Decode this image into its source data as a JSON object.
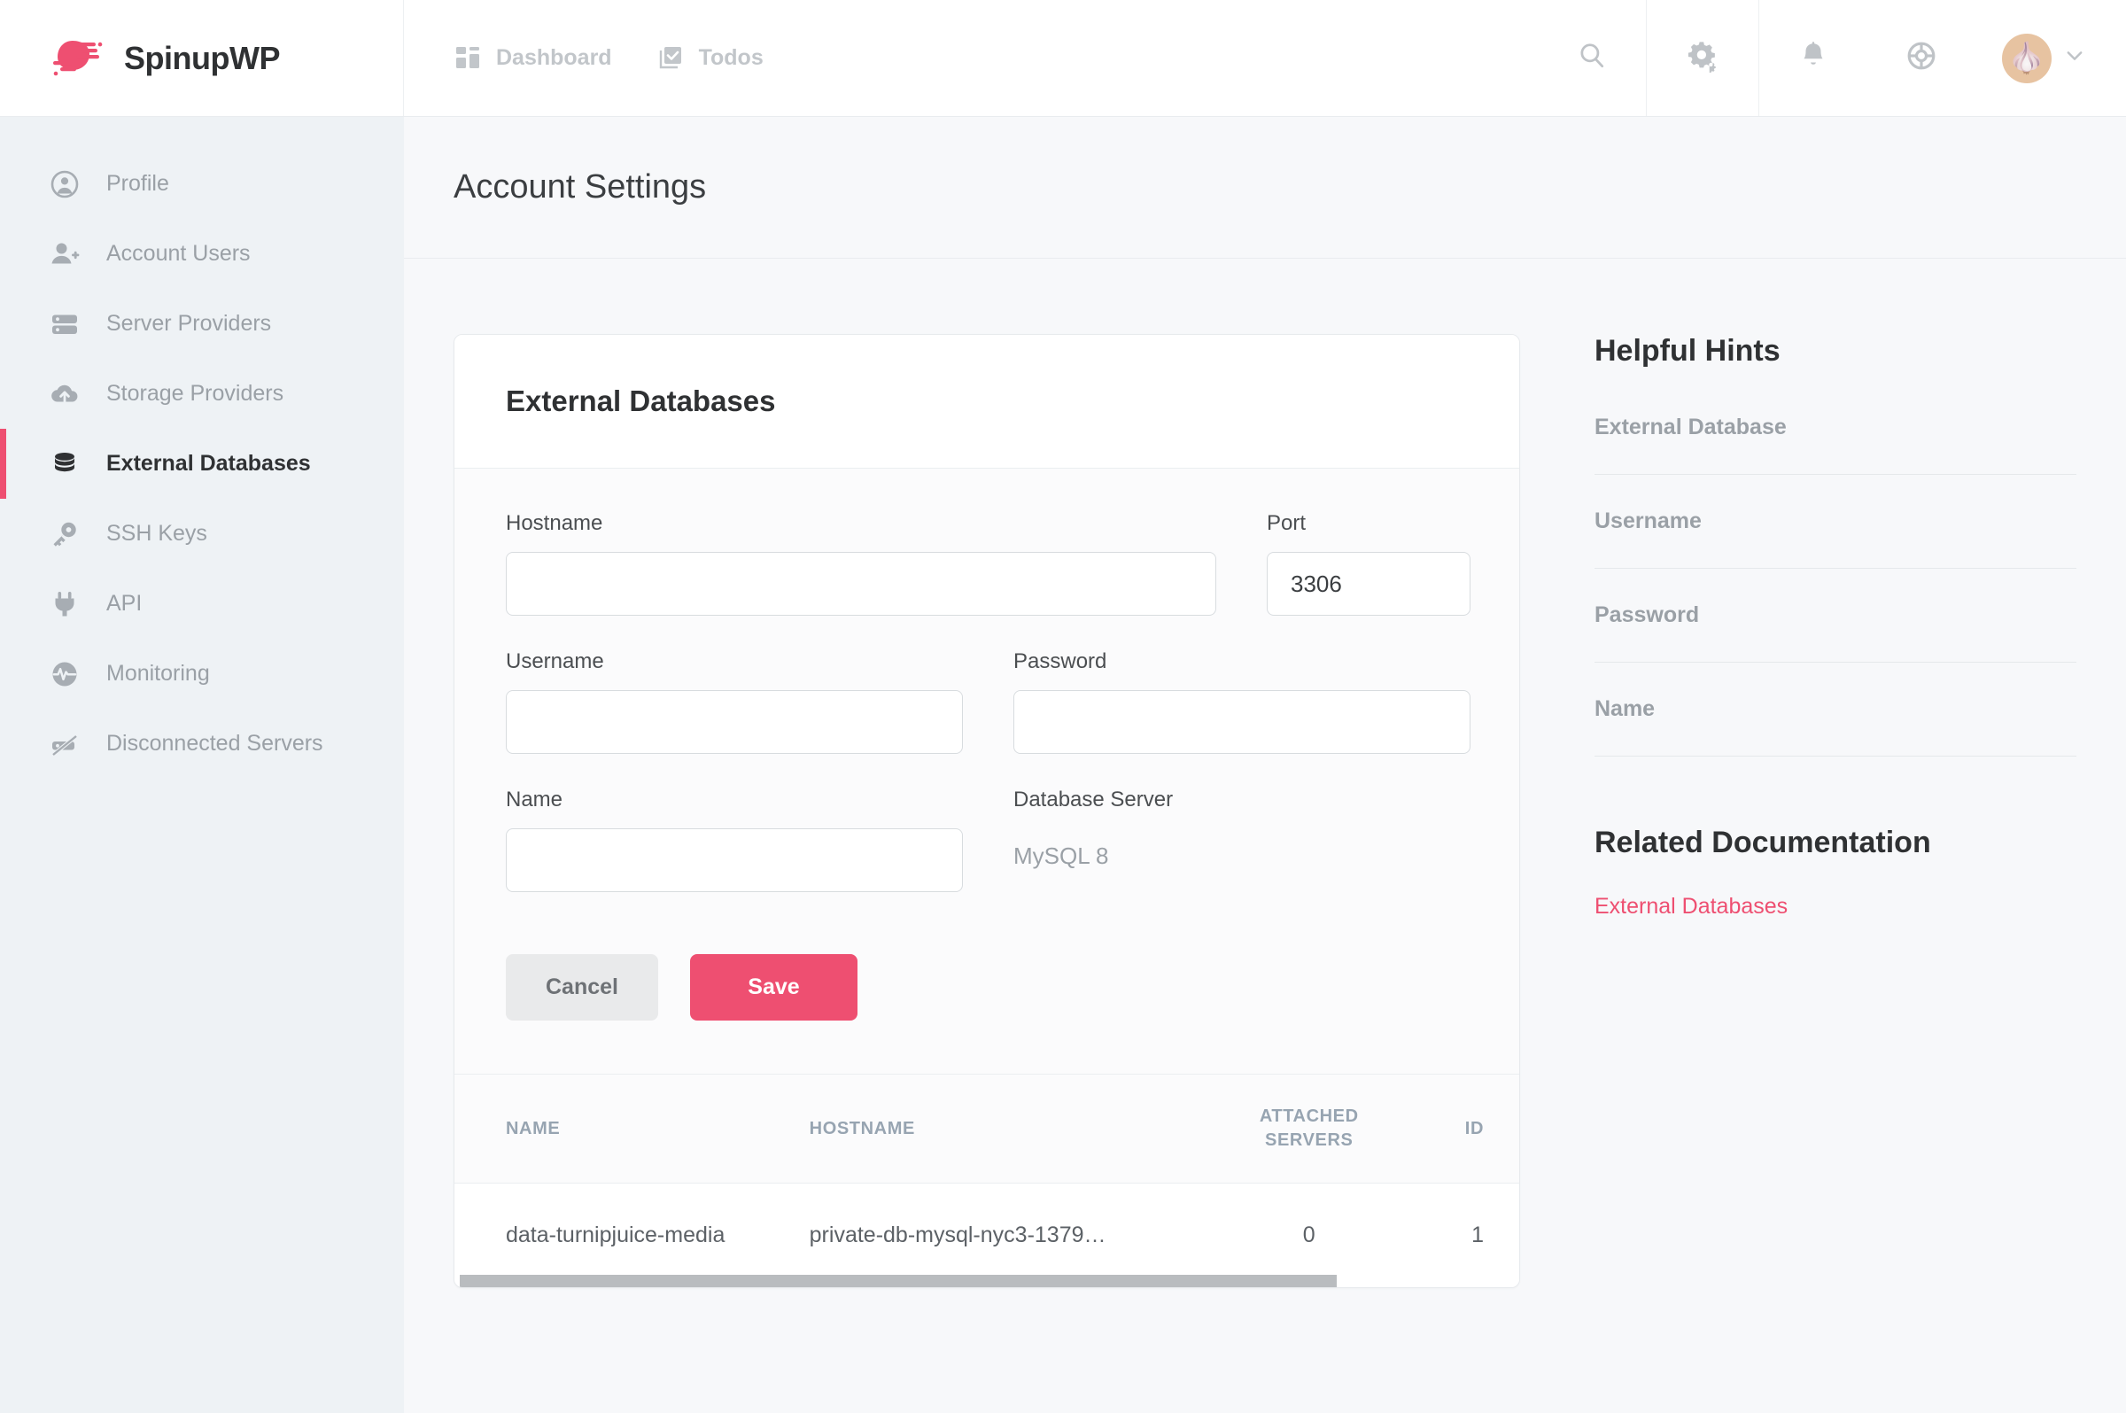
{
  "brand": {
    "name": "SpinupWP",
    "logo_color": "#ee4f71"
  },
  "topnav": {
    "items": [
      {
        "label": "Dashboard",
        "icon": "dashboard-grid-icon"
      },
      {
        "label": "Todos",
        "icon": "checkbox-list-icon"
      }
    ]
  },
  "topright": {
    "search": "search-icon",
    "settings": "gears-icon",
    "notifications": "bell-icon",
    "help": "life-ring-icon",
    "avatar_emoji": "🧄",
    "avatar_caret": "chevron-down-icon"
  },
  "sidebar": {
    "items": [
      {
        "label": "Profile",
        "icon": "user-circle-icon",
        "active": false
      },
      {
        "label": "Account Users",
        "icon": "user-plus-icon",
        "active": false
      },
      {
        "label": "Server Providers",
        "icon": "server-icon",
        "active": false
      },
      {
        "label": "Storage Providers",
        "icon": "cloud-upload-icon",
        "active": false
      },
      {
        "label": "External Databases",
        "icon": "database-icon",
        "active": true
      },
      {
        "label": "SSH Keys",
        "icon": "key-icon",
        "active": false
      },
      {
        "label": "API",
        "icon": "plug-icon",
        "active": false
      },
      {
        "label": "Monitoring",
        "icon": "pulse-circle-icon",
        "active": false
      },
      {
        "label": "Disconnected Servers",
        "icon": "unplugged-icon",
        "active": false
      }
    ]
  },
  "page": {
    "title": "Account Settings"
  },
  "card": {
    "title": "External Databases",
    "fields": {
      "hostname": {
        "label": "Hostname",
        "value": "",
        "placeholder": ""
      },
      "port": {
        "label": "Port",
        "value": "3306",
        "placeholder": ""
      },
      "username": {
        "label": "Username",
        "value": "",
        "placeholder": ""
      },
      "password": {
        "label": "Password",
        "value": "",
        "placeholder": ""
      },
      "name": {
        "label": "Name",
        "value": "",
        "placeholder": ""
      },
      "database_server": {
        "label": "Database Server",
        "value": "MySQL 8"
      }
    },
    "buttons": {
      "cancel": "Cancel",
      "save": "Save"
    }
  },
  "table": {
    "columns": [
      {
        "key": "name",
        "label": "NAME"
      },
      {
        "key": "hostname",
        "label": "HOSTNAME"
      },
      {
        "key": "attached_servers",
        "label": "ATTACHED SERVERS",
        "line1": "ATTACHED",
        "line2": "SERVERS"
      },
      {
        "key": "id",
        "label": "ID"
      }
    ],
    "rows": [
      {
        "name": "data-turnipjuice-media",
        "hostname": "private-db-mysql-nyc3-1379…",
        "attached_servers": "0",
        "id": "1"
      }
    ]
  },
  "rail": {
    "hints_title": "Helpful Hints",
    "hints": [
      {
        "term": "External Database"
      },
      {
        "term": "Username"
      },
      {
        "term": "Password"
      },
      {
        "term": "Name"
      }
    ],
    "docs_title": "Related Documentation",
    "docs_links": [
      {
        "label": "External Databases"
      }
    ]
  },
  "colors": {
    "accent": "#ee4f71",
    "sidebar_bg": "#eef2f5",
    "page_bg": "#f7f8fa"
  }
}
